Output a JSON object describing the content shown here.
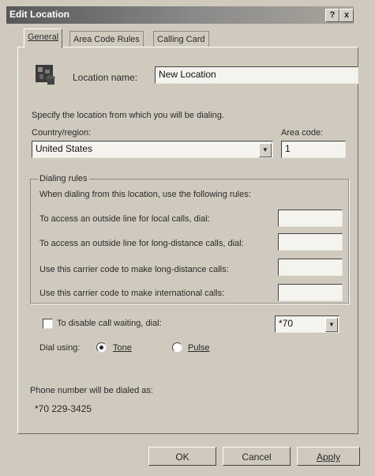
{
  "window": {
    "title": "Edit Location",
    "help_btn": "?",
    "close_btn": "x"
  },
  "tabs": [
    {
      "label": "General",
      "active": true
    },
    {
      "label": "Area Code Rules",
      "active": false
    },
    {
      "label": "Calling Card",
      "active": false
    }
  ],
  "general": {
    "location_name_label": "Location name:",
    "location_name_value": "New Location",
    "specify_text": "Specify the location from which you will be dialing.",
    "country_label": "Country/region:",
    "country_value": "United States",
    "area_code_label": "Area code:",
    "area_code_value": "1",
    "dialing_rules": {
      "legend": "Dialing rules",
      "intro": "When dialing from this location, use the following rules:",
      "rows": [
        {
          "label": "To access an outside line for local calls, dial:",
          "value": ""
        },
        {
          "label": "To access an outside line for long-distance calls, dial:",
          "value": ""
        },
        {
          "label": "Use this carrier code to make long-distance calls:",
          "value": ""
        },
        {
          "label": "Use this carrier code to make international calls:",
          "value": ""
        }
      ]
    },
    "call_waiting_label": "To disable call waiting, dial:",
    "call_waiting_checked": false,
    "call_waiting_value": "*70",
    "dial_using_label": "Dial using:",
    "tone_label": "Tone",
    "pulse_label": "Pulse",
    "selected_dial_mode": "Tone",
    "phone_number_label": "Phone number will be dialed as:",
    "phone_number_value": "*70 229-3425"
  },
  "buttons": {
    "ok": "OK",
    "cancel": "Cancel",
    "apply": "Apply"
  }
}
